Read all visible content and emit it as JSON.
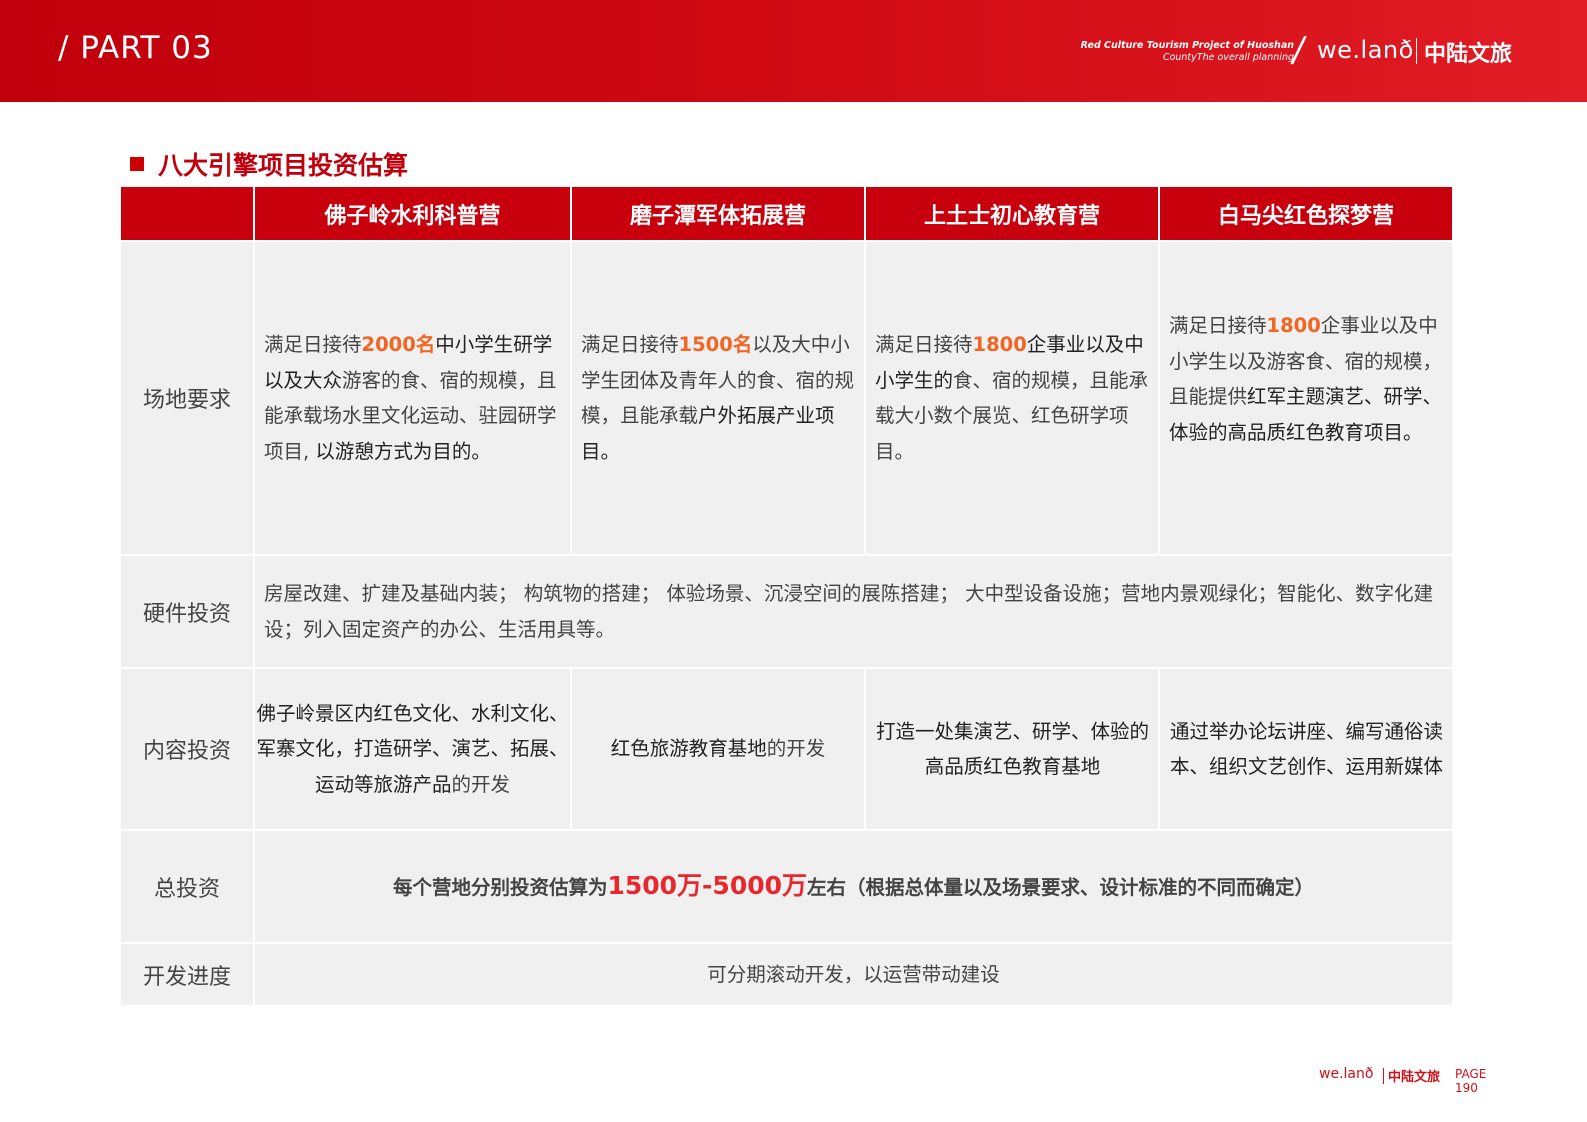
{
  "header": {
    "part": "/ PART 03",
    "subtitle_line1": "Red Culture Tourism Project of Huoshan",
    "subtitle_line2": "CountyThe overall planning",
    "brand_slash": "/",
    "brand_en": "we.lanð",
    "brand_cn": "中陆文旅"
  },
  "section": {
    "title": "八大引擎项目投资估算"
  },
  "table": {
    "columns": [
      "佛子岭水利科普营",
      "磨子潭军体拓展营",
      "上土士初心教育营",
      "白马尖红色探梦营"
    ],
    "rows": {
      "site": {
        "label": "场地要求",
        "c1": {
          "pre": "满足日接待",
          "hl": "2000名",
          "dark": "中小学生研学以及大众",
          "mid": "游客的食、宿的规模，且能承载场水里文化运动、驻园研学项目, ",
          "dark2": "以游憩方式为目的。"
        },
        "c2": {
          "pre": "满足日接待",
          "hl": "1500名",
          "mid": "以及大中小学生团体及青年人的食、宿的规模，且能承载",
          "dark": "户外拓展产业项目。"
        },
        "c3": {
          "pre": "满足日接待",
          "hl": "1800",
          "dark": "企事业以及中小学生的",
          "mid": "食、宿的规模，且能承载大小数个展览、红色研学项目。"
        },
        "c4": {
          "pre": "满足日接待",
          "hl": "1800",
          "mid": "企事业以及中小学生以及游客食、宿的规模，且能提供",
          "dark": "红军主题演艺、研学、体验的高品质红色教育项目。"
        }
      },
      "hardware": {
        "label": "硬件投资",
        "text": "房屋改建、扩建及基础内装； 构筑物的搭建； 体验场景、沉浸空间的展陈搭建； 大中型设备设施；营地内景观绿化；智能化、数字化建设；列入固定资产的办公、生活用具等。"
      },
      "content": {
        "label": "内容投资",
        "c1_dark": "佛子岭景区内红色文化、水利文化、军寨文化，打造研学、演艺、拓展、运动等旅游产品",
        "c1_tail": "的开发",
        "c2_dark": "红色旅游教育基地",
        "c2_tail": "的开发",
        "c3": "打造一处集演艺、研学、体验的高品质红色教育基地",
        "c4": "通过举办论坛讲座、编写通俗读本、组织文艺创作、运用新媒体"
      },
      "total": {
        "label": "总投资",
        "pre": "每个营地分别投资估算为",
        "big": "1500万-5000万",
        "post": "左右（根据总体量以及场景要求、设计标准的不同而确定）"
      },
      "progress": {
        "label": "开发进度",
        "text": "可分期滚动开发，以运营带动建设"
      }
    }
  },
  "footer": {
    "brand_en": "we.lanð",
    "brand_cn": "中陆文旅",
    "page_label": "PAGE",
    "page_number": "190"
  },
  "colors": {
    "brand_red": "#c8000d",
    "highlight_orange": "#f26522",
    "cell_bg": "#f0f0f0"
  }
}
